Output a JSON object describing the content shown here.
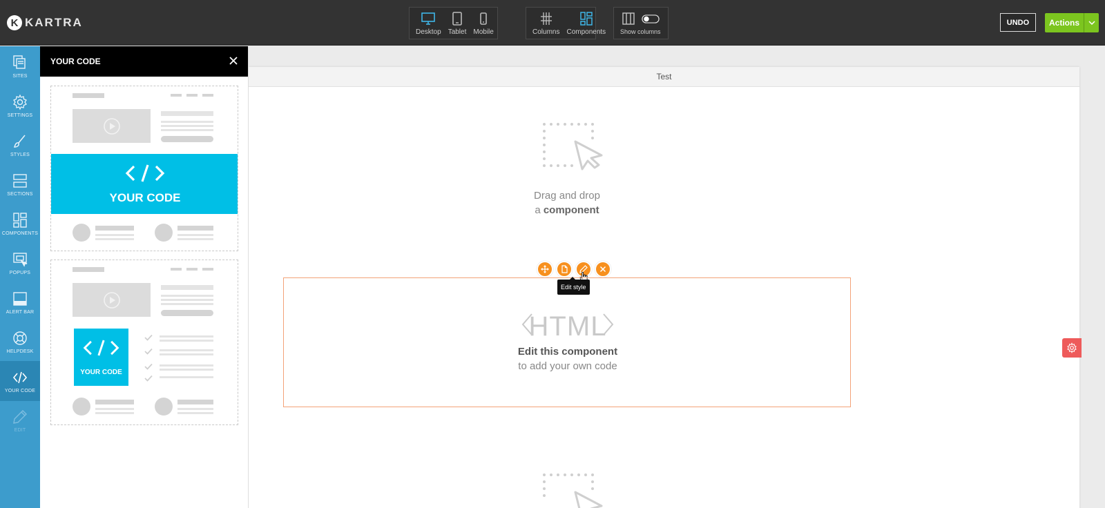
{
  "brand": {
    "mark": "K",
    "name": "KARTRA"
  },
  "toolbar": {
    "devices": [
      {
        "label": "Desktop",
        "active": true
      },
      {
        "label": "Tablet",
        "active": false
      },
      {
        "label": "Mobile",
        "active": false
      }
    ],
    "columns_label": "Columns",
    "components_label": "Components",
    "show_columns_label": "Show columns",
    "undo_label": "UNDO",
    "actions_label": "Actions"
  },
  "rail": {
    "items": [
      {
        "label": "SITES",
        "icon": "sites-icon"
      },
      {
        "label": "SETTINGS",
        "icon": "gear-icon"
      },
      {
        "label": "STYLES",
        "icon": "brush-icon"
      },
      {
        "label": "SECTIONS",
        "icon": "sections-icon"
      },
      {
        "label": "COMPONENTS",
        "icon": "components-icon"
      },
      {
        "label": "POPUPS",
        "icon": "popups-icon"
      },
      {
        "label": "ALERT BAR",
        "icon": "alert-bar-icon"
      },
      {
        "label": "HELPDESK",
        "icon": "helpdesk-icon"
      },
      {
        "label": "YOUR CODE",
        "icon": "code-icon",
        "active": true
      },
      {
        "label": "EDIT",
        "icon": "pencil-icon",
        "disabled": true
      }
    ]
  },
  "panel": {
    "title": "YOUR CODE",
    "templates": [
      {
        "label": "YOUR CODE"
      },
      {
        "label": "YOUR CODE"
      }
    ]
  },
  "canvas": {
    "page_title": "Test",
    "dropzone_top": {
      "line1": "Drag and drop",
      "line2_prefix": "a ",
      "line2_bold": "component"
    },
    "html_component": {
      "title": "HTML",
      "subtitle_bold": "Edit this component",
      "subtitle": "to add your own code"
    },
    "tools": [
      "move-icon",
      "duplicate-icon",
      "edit-style-icon",
      "delete-icon"
    ],
    "tooltip": "Edit style"
  },
  "colors": {
    "topbar": "#333333",
    "rail": "#3d9ccc",
    "accent_cyan": "#00bfe6",
    "accent_orange": "#f7901e",
    "actions_green": "#7cc51f",
    "danger": "#ee5a5a"
  }
}
